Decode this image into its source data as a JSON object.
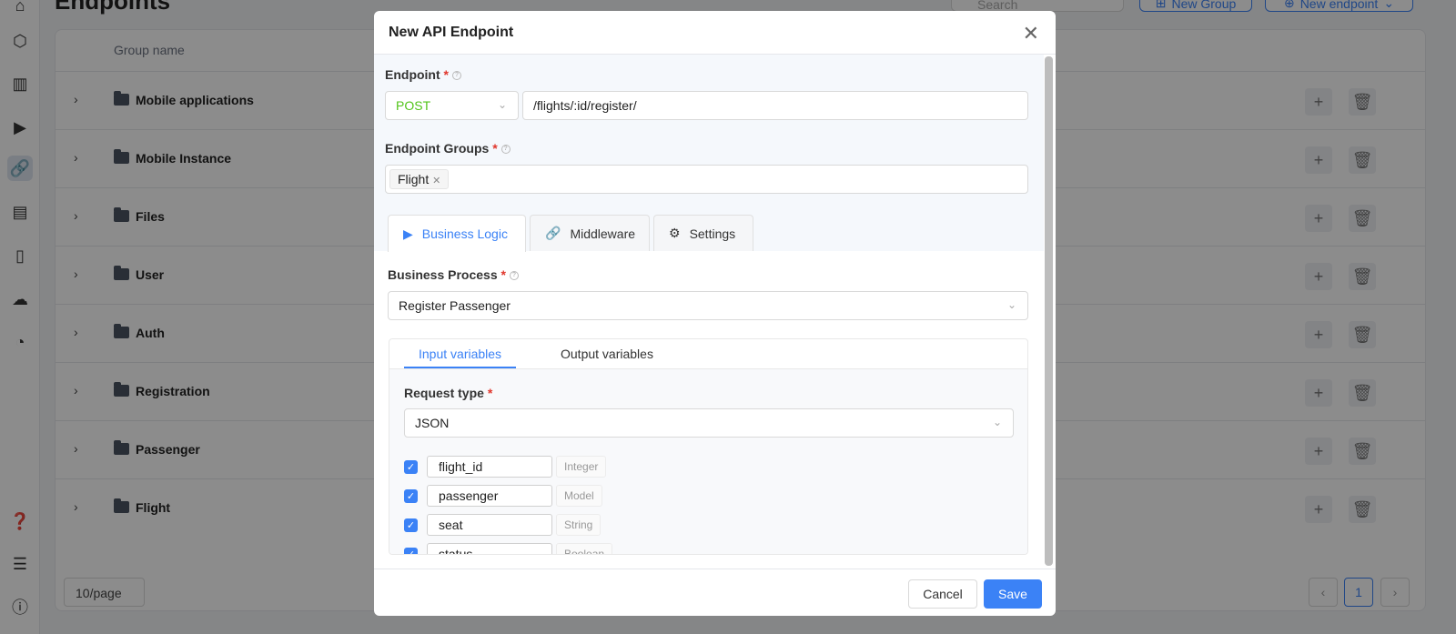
{
  "page": {
    "title": "Endpoints",
    "search_placeholder": "Search",
    "new_group": "New Group",
    "new_endpoint": "New endpoint"
  },
  "sidebar": {
    "items": [
      {
        "icon": "home-icon"
      },
      {
        "icon": "cube-icon"
      },
      {
        "icon": "board-icon"
      },
      {
        "icon": "play-icon"
      },
      {
        "icon": "link-icon",
        "active": true
      },
      {
        "icon": "layout-icon"
      },
      {
        "icon": "mobile-icon"
      },
      {
        "icon": "cloud-upload-icon"
      },
      {
        "icon": "dashboard-icon"
      },
      {
        "icon": "help-icon"
      },
      {
        "icon": "docs-icon"
      },
      {
        "icon": "info-icon"
      }
    ]
  },
  "table": {
    "header": "Group name",
    "rows": [
      "Mobile applications",
      "Mobile Instance",
      "Files",
      "User",
      "Auth",
      "Registration",
      "Passenger",
      "Flight"
    ]
  },
  "pagination": {
    "page_size": "10/page",
    "current": "1"
  },
  "modal": {
    "title": "New API Endpoint",
    "endpoint_label": "Endpoint",
    "method": "POST",
    "method_color": "#52c41a",
    "path": "/flights/:id/register/",
    "groups_label": "Endpoint Groups",
    "groups": [
      "Flight"
    ],
    "tabs": [
      "Business Logic",
      "Middleware",
      "Settings"
    ],
    "active_tab": "Business Logic",
    "process_label": "Business Process",
    "process": "Register Passenger",
    "inner_tabs": [
      "Input variables",
      "Output variables"
    ],
    "request_type_label": "Request type",
    "request_type": "JSON",
    "variables": [
      {
        "name": "flight_id",
        "type": "Integer",
        "checked": true
      },
      {
        "name": "passenger",
        "type": "Model",
        "checked": true
      },
      {
        "name": "seat",
        "type": "String",
        "checked": true
      },
      {
        "name": "status",
        "type": "Boolean",
        "checked": true
      }
    ],
    "cancel": "Cancel",
    "save": "Save",
    "accent": "#3b82f6"
  }
}
